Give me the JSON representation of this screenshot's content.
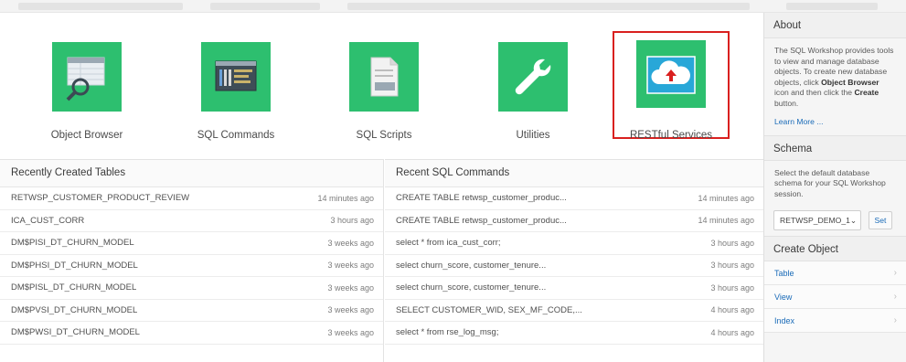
{
  "tiles": [
    {
      "label": "Object Browser",
      "icon": "object-browser-icon"
    },
    {
      "label": "SQL Commands",
      "icon": "sql-commands-icon"
    },
    {
      "label": "SQL Scripts",
      "icon": "sql-scripts-icon"
    },
    {
      "label": "Utilities",
      "icon": "wrench-icon"
    },
    {
      "label": "RESTful Services",
      "icon": "cloud-upload-icon",
      "selected": true
    }
  ],
  "recent_tables": {
    "title": "Recently Created Tables",
    "rows": [
      {
        "name": "RETWSP_CUSTOMER_PRODUCT_REVIEW",
        "time": "14 minutes ago"
      },
      {
        "name": "ICA_CUST_CORR",
        "time": "3 hours ago"
      },
      {
        "name": "DM$PISI_DT_CHURN_MODEL",
        "time": "3 weeks ago"
      },
      {
        "name": "DM$PHSI_DT_CHURN_MODEL",
        "time": "3 weeks ago"
      },
      {
        "name": "DM$PISL_DT_CHURN_MODEL",
        "time": "3 weeks ago"
      },
      {
        "name": "DM$PVSI_DT_CHURN_MODEL",
        "time": "3 weeks ago"
      },
      {
        "name": "DM$PWSI_DT_CHURN_MODEL",
        "time": "3 weeks ago"
      }
    ]
  },
  "recent_sql": {
    "title": "Recent SQL Commands",
    "rows": [
      {
        "name": "CREATE TABLE retwsp_customer_produc...",
        "time": "14 minutes ago"
      },
      {
        "name": "CREATE TABLE retwsp_customer_produc...",
        "time": "14 minutes ago"
      },
      {
        "name": "select * from ica_cust_corr;",
        "time": "3 hours ago"
      },
      {
        "name": "select churn_score, customer_tenure...",
        "time": "3 hours ago"
      },
      {
        "name": "select churn_score, customer_tenure...",
        "time": "3 hours ago"
      },
      {
        "name": "SELECT CUSTOMER_WID, SEX_MF_CODE,...",
        "time": "4 hours ago"
      },
      {
        "name": "select * from rse_log_msg;",
        "time": "4 hours ago"
      }
    ]
  },
  "sidebar": {
    "about": {
      "title": "About",
      "text_1": "The SQL Workshop provides tools to view and manage database objects. To create new database objects, click ",
      "bold_1": "Object Browser",
      "text_2": " icon and then click the ",
      "bold_2": "Create",
      "text_3": " button.",
      "link": "Learn More ..."
    },
    "schema": {
      "title": "Schema",
      "text": "Select the default database schema for your SQL Workshop session.",
      "selected": "RETWSP_DEMO_1",
      "set_label": "Set"
    },
    "create_object": {
      "title": "Create Object",
      "items": [
        "Table",
        "View",
        "Index"
      ]
    }
  },
  "colors": {
    "tile_green": "#2dbf6f",
    "highlight_red": "#d9201f",
    "link_blue": "#1a6bb8"
  }
}
